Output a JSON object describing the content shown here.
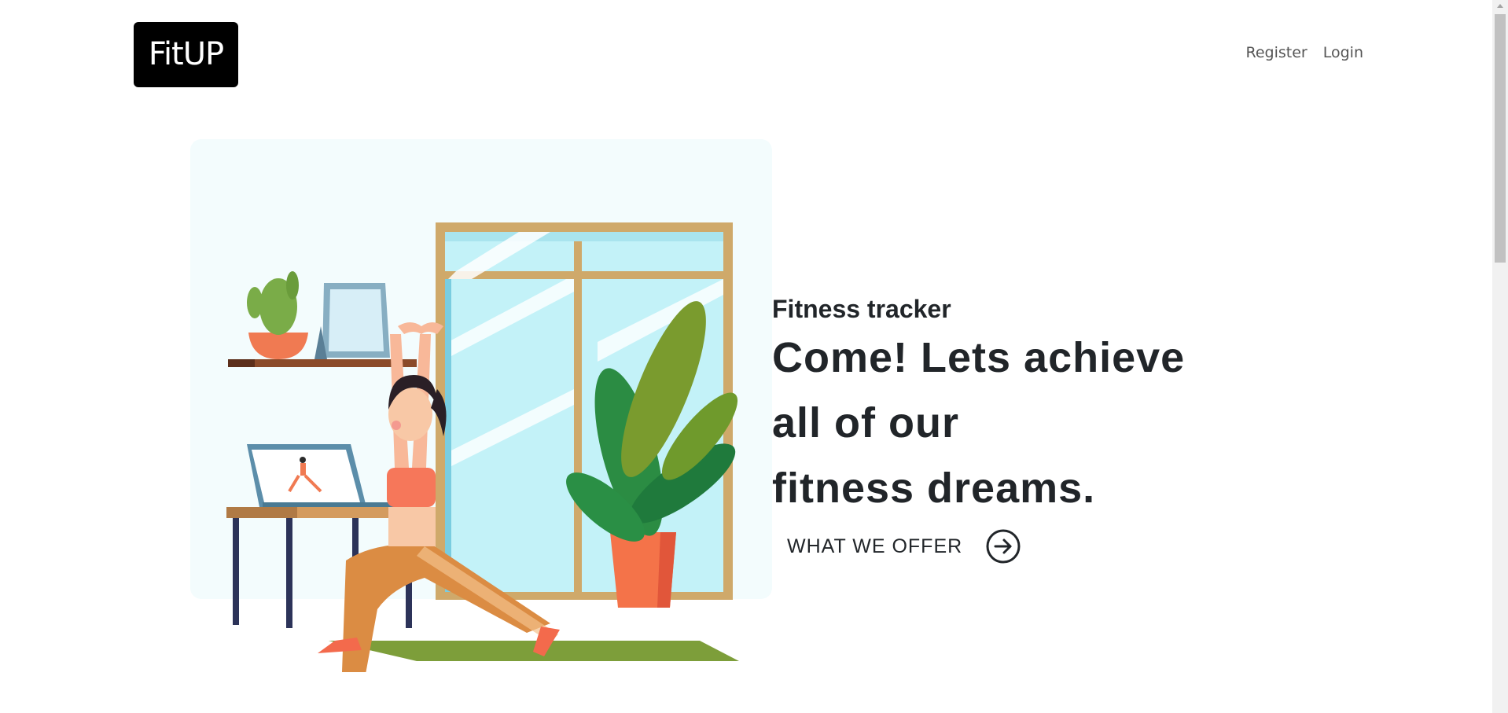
{
  "brand": {
    "logo_text": "FitUP"
  },
  "nav": {
    "links": [
      {
        "label": "Register"
      },
      {
        "label": "Login"
      }
    ]
  },
  "hero": {
    "eyebrow": "Fitness tracker",
    "headline_lines": [
      "Come! Lets achieve",
      "all of our",
      "fitness dreams."
    ],
    "cta_label": "WHAT WE OFFER",
    "cta_icon": "arrow-right-circle-icon",
    "illustration": "woman-stretching-illustration"
  },
  "colors": {
    "logo_bg": "#000000",
    "text": "#212529",
    "nav_text": "#555555",
    "illustration_bg": "#f3fcfd"
  }
}
